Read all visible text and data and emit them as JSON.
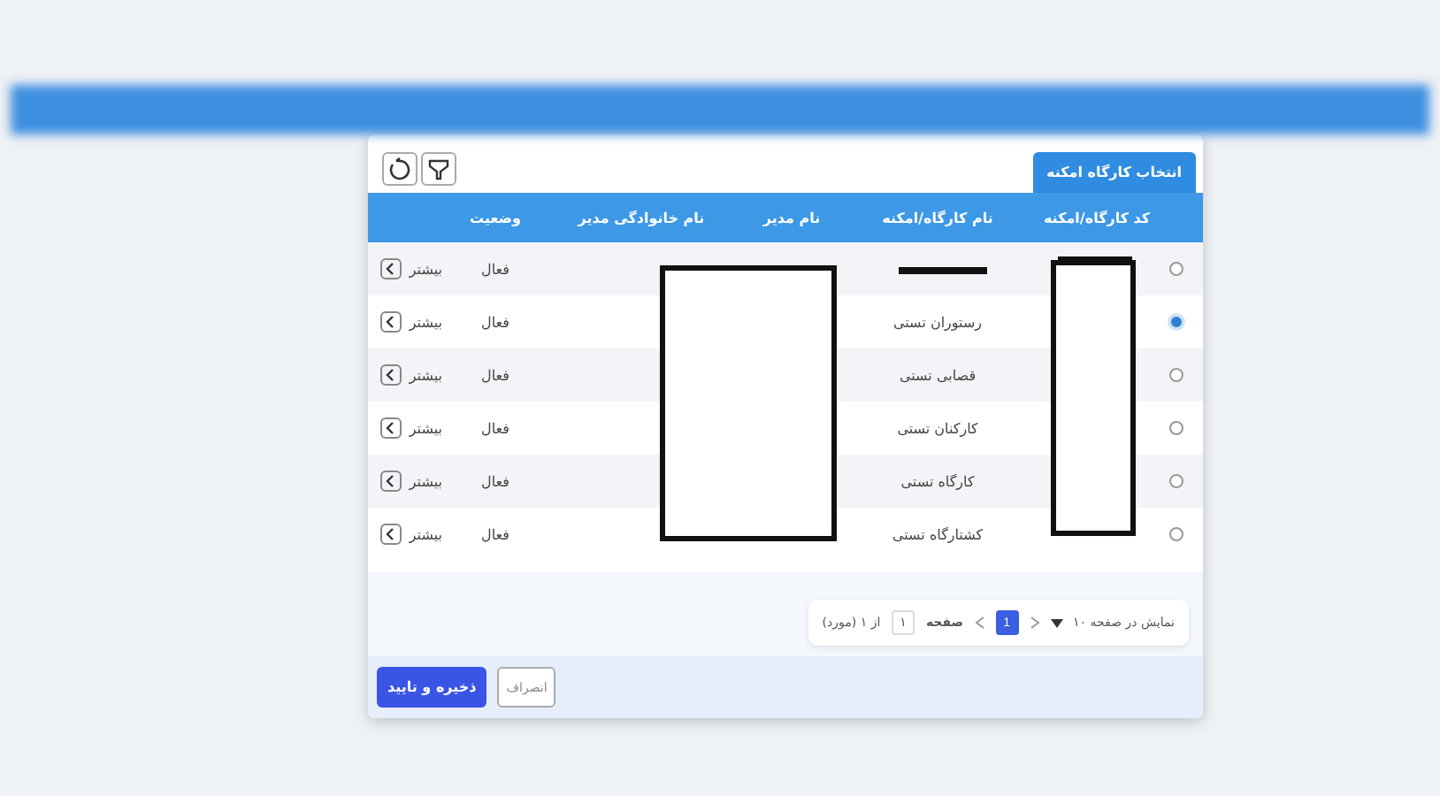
{
  "dialog": {
    "tab": "انتخاب کارگاه امکنه",
    "columns": [
      "کد کارگاه/امکنه",
      "نام کارگاه/امکنه",
      "نام مدیر",
      "نام خانوادگی مدیر",
      "وضعیت"
    ],
    "rows": [
      {
        "selected": false,
        "status": "فعال",
        "more": "بیشتر"
      },
      {
        "selected": true,
        "name": "رستوران تستی",
        "status": "فعال",
        "more": "بیشتر"
      },
      {
        "selected": false,
        "name": "قصابی تستی",
        "status": "فعال",
        "more": "بیشتر"
      },
      {
        "selected": false,
        "name": "کارکنان تستی",
        "status": "فعال",
        "more": "بیشتر"
      },
      {
        "selected": false,
        "name": "کارگاه تستی",
        "status": "فعال",
        "more": "بیشتر"
      },
      {
        "selected": false,
        "name": "کشتارگاه تستی",
        "status": "فعال",
        "more": "بیشتر"
      }
    ],
    "pagination": {
      "page_size_label": "نمایش در صفحه ۱۰",
      "pages": [
        {
          "label": "1",
          "selected": true
        }
      ],
      "page_label": "صفحه",
      "page_input": "۱",
      "total": "از ۱ (مورد)"
    },
    "buttons": {
      "save": "ذخیره و تایید",
      "cancel": "انصراف"
    }
  }
}
